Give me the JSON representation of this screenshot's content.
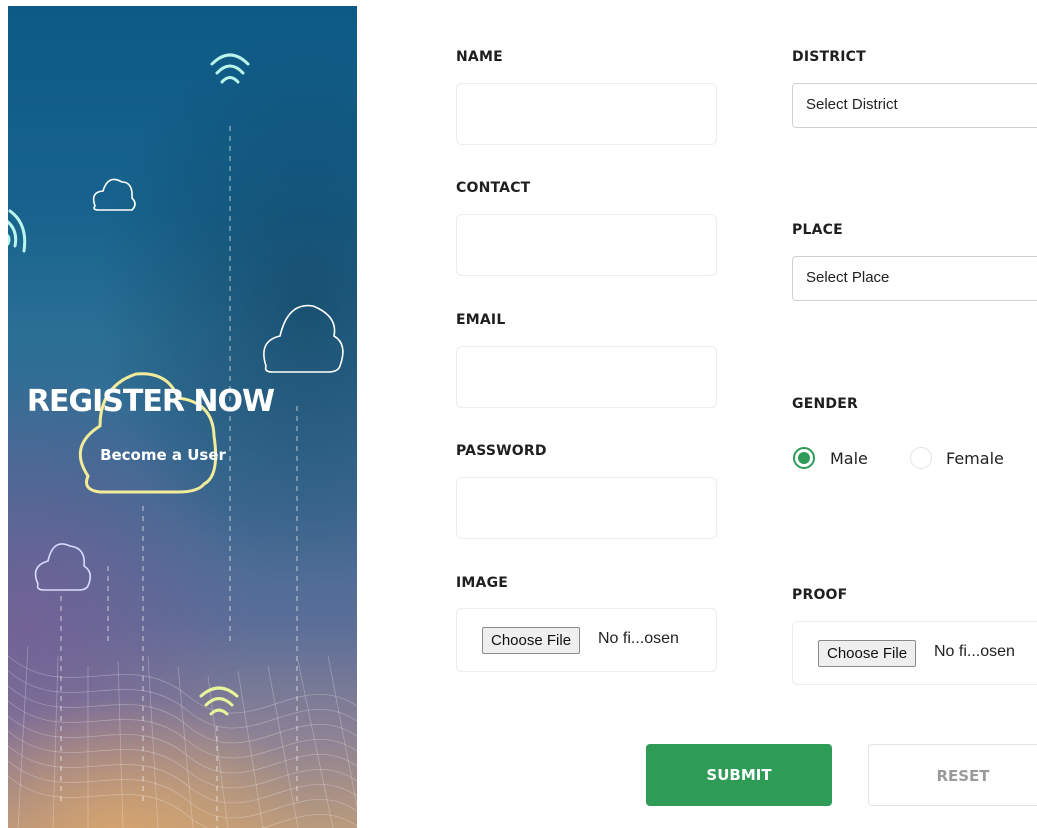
{
  "hero": {
    "title": "REGISTER NOW",
    "subtitle": "Become a User",
    "icons": [
      "wifi-icon",
      "cloud-icon",
      "wave-mesh"
    ]
  },
  "form": {
    "name": {
      "label": "NAME",
      "value": ""
    },
    "contact": {
      "label": "CONTACT",
      "value": ""
    },
    "email": {
      "label": "EMAIL",
      "value": ""
    },
    "password": {
      "label": "PASSWORD",
      "value": ""
    },
    "image": {
      "label": "IMAGE",
      "button": "Choose File",
      "status": "No fi...osen"
    },
    "district": {
      "label": "DISTRICT",
      "selected": "Select District"
    },
    "place": {
      "label": "PLACE",
      "selected": "Select Place"
    },
    "gender": {
      "label": "GENDER",
      "options": [
        "Male",
        "Female"
      ],
      "selected": "Male"
    },
    "proof": {
      "label": "PROOF",
      "button": "Choose File",
      "status": "No fi...osen"
    }
  },
  "actions": {
    "submit": "SUBMIT",
    "reset": "RESET"
  },
  "colors": {
    "accent": "#2e9b57",
    "hero_top": "#0d5a86",
    "hero_bottom": "#b99a7c"
  }
}
